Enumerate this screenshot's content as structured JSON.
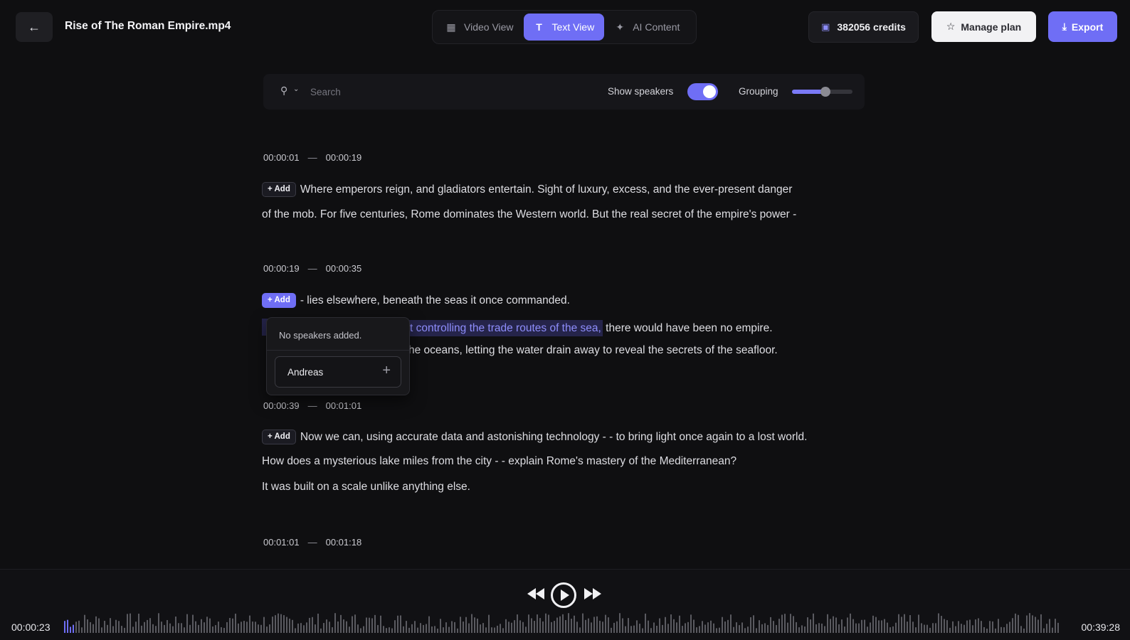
{
  "header": {
    "title": "Rise of The Roman Empire.mp4",
    "tabs": [
      {
        "label": "Video View",
        "icon": "film-icon",
        "active": false
      },
      {
        "label": "Text View",
        "icon": "text-icon",
        "active": true
      },
      {
        "label": "AI Content",
        "icon": "magic-wand-icon",
        "active": false
      }
    ],
    "credits": "382056 credits",
    "manage_plan": "Manage plan",
    "export": "Export"
  },
  "toolbar": {
    "search_placeholder": "Search",
    "show_speakers_label": "Show speakers",
    "show_speakers_on": true,
    "grouping_label": "Grouping",
    "grouping_level": 0.55
  },
  "transcript": {
    "add_label": "+ Add",
    "blocks": [
      {
        "start": "00:00:01",
        "end": "00:00:19",
        "lines": [
          "Where emperors reign, and gladiators entertain. Sight of luxury, excess, and the ever-present danger",
          "of the mob. For five centuries, Rome dominates the Western world. But the real secret of the empire's power -"
        ]
      },
      {
        "start": "00:00:19",
        "end": "00:00:35",
        "lines": [
          "- lies elsewhere, beneath the seas it once commanded.",
          "t controlling the trade routes of the sea,",
          "there would have been no empire.",
          "he oceans, letting the water drain away to reveal the secrets of the seafloor."
        ]
      },
      {
        "start": "00:00:39",
        "end": "00:01:01",
        "lines": [
          "Now we can, using accurate data and astonishing technology - - to bring light once again to a lost world.",
          "How does a mysterious lake miles from the city - - explain Rome's mastery of the Mediterranean?",
          "It was built on a scale unlike anything else."
        ]
      },
      {
        "start": "00:01:01",
        "end": "00:01:18",
        "lines": []
      }
    ]
  },
  "speaker_popup": {
    "empty_text": "No speakers added.",
    "speaker_name": "Andreas"
  },
  "player": {
    "current_time": "00:00:23",
    "total_time": "00:39:28",
    "progress": 0.0097
  },
  "colors": {
    "accent": "#6f6ef5",
    "background": "#0f0f11",
    "highlight_text": "#8e8dfb"
  }
}
